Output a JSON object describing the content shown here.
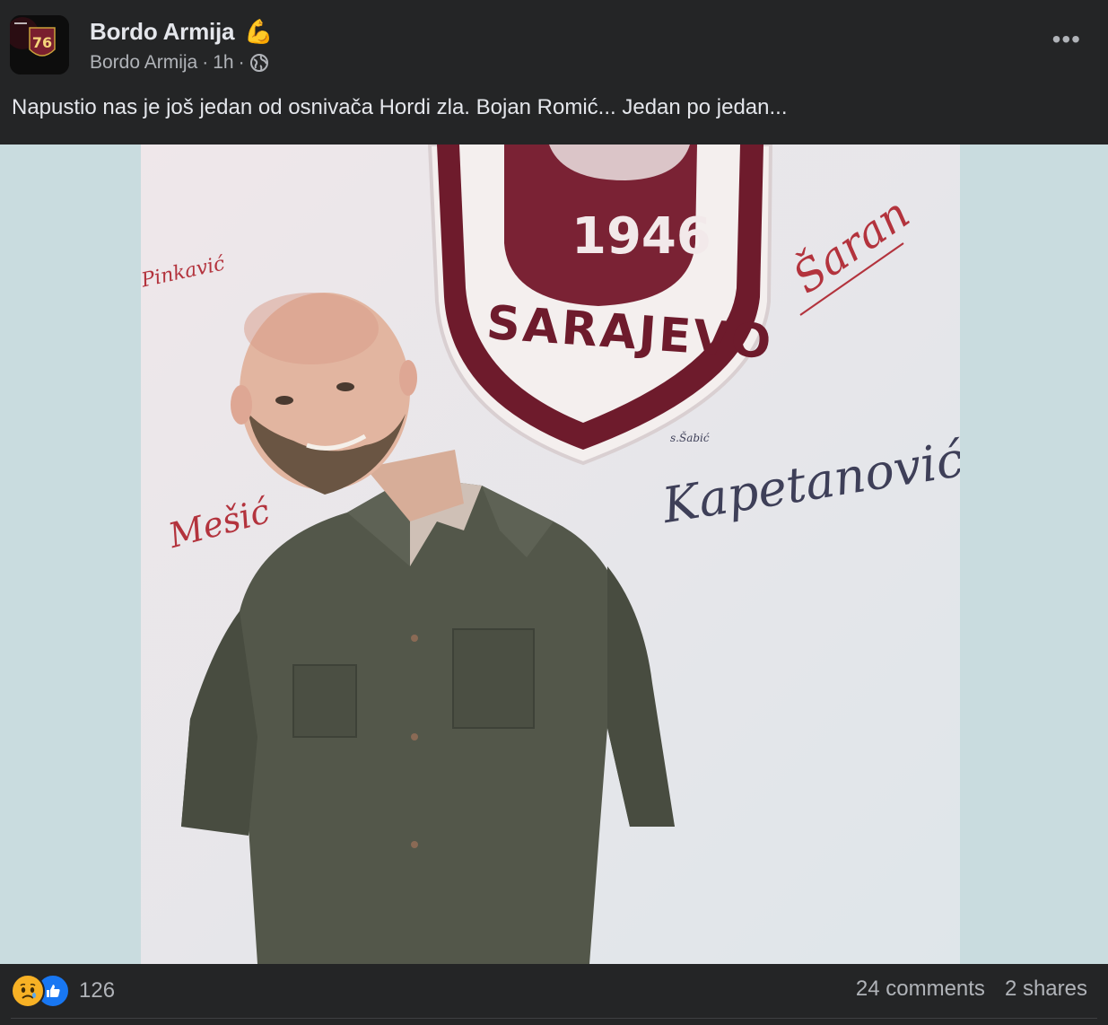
{
  "post": {
    "author": "Bordo Armija",
    "author_emoji": "💪",
    "meta_name": "Bordo Armija",
    "meta_sep": "·",
    "time": "1h",
    "meta_sep2": "·",
    "privacy_icon": "globe-icon",
    "more_icon": "•••",
    "text": "Napustio nas je još jedan od osnivača Hordi zla. Bojan Romić... Jedan po jedan..."
  },
  "photo": {
    "crest_year": "1946",
    "crest_name": "SARAJEVO",
    "signatures": {
      "kapetanovic": "Kapetanović",
      "kapetanovic_small": "s.Šabić",
      "saran": "Šaran",
      "red1": "Pinkavić",
      "red2": "Mešić"
    }
  },
  "footer": {
    "reaction_icons": [
      "sad-reaction-icon",
      "like-reaction-icon"
    ],
    "reaction_count": "126",
    "comments": "24 comments",
    "shares": "2 shares"
  },
  "colors": {
    "background": "#242526",
    "text": "#e4e6eb",
    "secondary": "#b0b3b8",
    "like_blue": "#1877f2",
    "sad_yellow": "#f7b125",
    "crest_maroon": "#6e1b2c"
  }
}
